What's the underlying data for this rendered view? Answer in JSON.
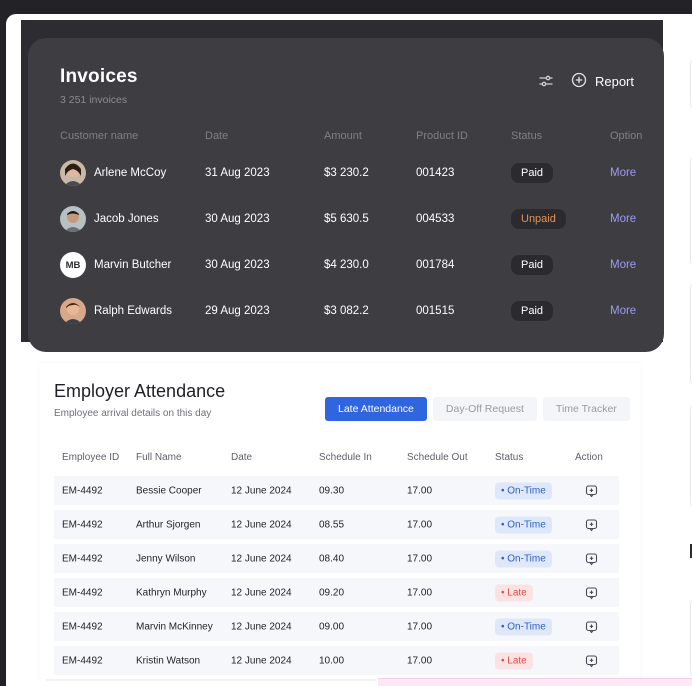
{
  "invoices": {
    "title": "Invoices",
    "subtitle": "3 251 invoices",
    "report_label": "Report",
    "columns": [
      "Customer name",
      "Date",
      "Amount",
      "Product ID",
      "Status",
      "Option"
    ],
    "rows": [
      {
        "name": "Arlene McCoy",
        "avatar": "photo-avatar",
        "date": "31 Aug 2023",
        "amount": "$3 230.2",
        "product": "001423",
        "status": "Paid",
        "option": "More"
      },
      {
        "name": "Jacob Jones",
        "avatar": "photo-avatar",
        "date": "30 Aug 2023",
        "amount": "$5 630.5",
        "product": "004533",
        "status": "Unpaid",
        "option": "More"
      },
      {
        "name": "Marvin Butcher",
        "avatar": "MB",
        "date": "30 Aug 2023",
        "amount": "$4 230.0",
        "product": "001784",
        "status": "Paid",
        "option": "More"
      },
      {
        "name": "Ralph Edwards",
        "avatar": "photo-avatar",
        "date": "29 Aug 2023",
        "amount": "$3 082.2",
        "product": "001515",
        "status": "Paid",
        "option": "More"
      }
    ],
    "colors": {
      "card": "#3d3d42",
      "link": "#9b9bf6",
      "unpaid": "#e0945a"
    }
  },
  "attendance": {
    "title": "Employer Attendance",
    "subtitle": "Employee arrival details on this day",
    "tabs": [
      "Late Attendance",
      "Day-Off Request",
      "Time Tracker"
    ],
    "active_tab": "Late Attendance",
    "columns": [
      "Employee ID",
      "Full Name",
      "Date",
      "Schedule In",
      "Schedule Out",
      "Status",
      "Action"
    ],
    "rows": [
      {
        "id": "EM-4492",
        "name": "Bessie Cooper",
        "date": "12 June 2024",
        "in": "09.30",
        "out": "17.00",
        "status": "• On-Time"
      },
      {
        "id": "EM-4492",
        "name": "Arthur Sjorgen",
        "date": "12 June 2024",
        "in": "08.55",
        "out": "17.00",
        "status": "• On-Time"
      },
      {
        "id": "EM-4492",
        "name": "Jenny Wilson",
        "date": "12 June 2024",
        "in": "08.40",
        "out": "17.00",
        "status": "• On-Time"
      },
      {
        "id": "EM-4492",
        "name": "Kathryn Murphy",
        "date": "12 June 2024",
        "in": "09.20",
        "out": "17.00",
        "status": "• Late"
      },
      {
        "id": "EM-4492",
        "name": "Marvin McKinney",
        "date": "12 June 2024",
        "in": "09.00",
        "out": "17.00",
        "status": "• On-Time"
      },
      {
        "id": "EM-4492",
        "name": "Kristin Watson",
        "date": "12 June 2024",
        "in": "10.00",
        "out": "17.00",
        "status": "• Late"
      }
    ],
    "colors": {
      "accent": "#2f66e0",
      "ontime": "#2f5ec9",
      "late": "#e24d4d"
    }
  }
}
